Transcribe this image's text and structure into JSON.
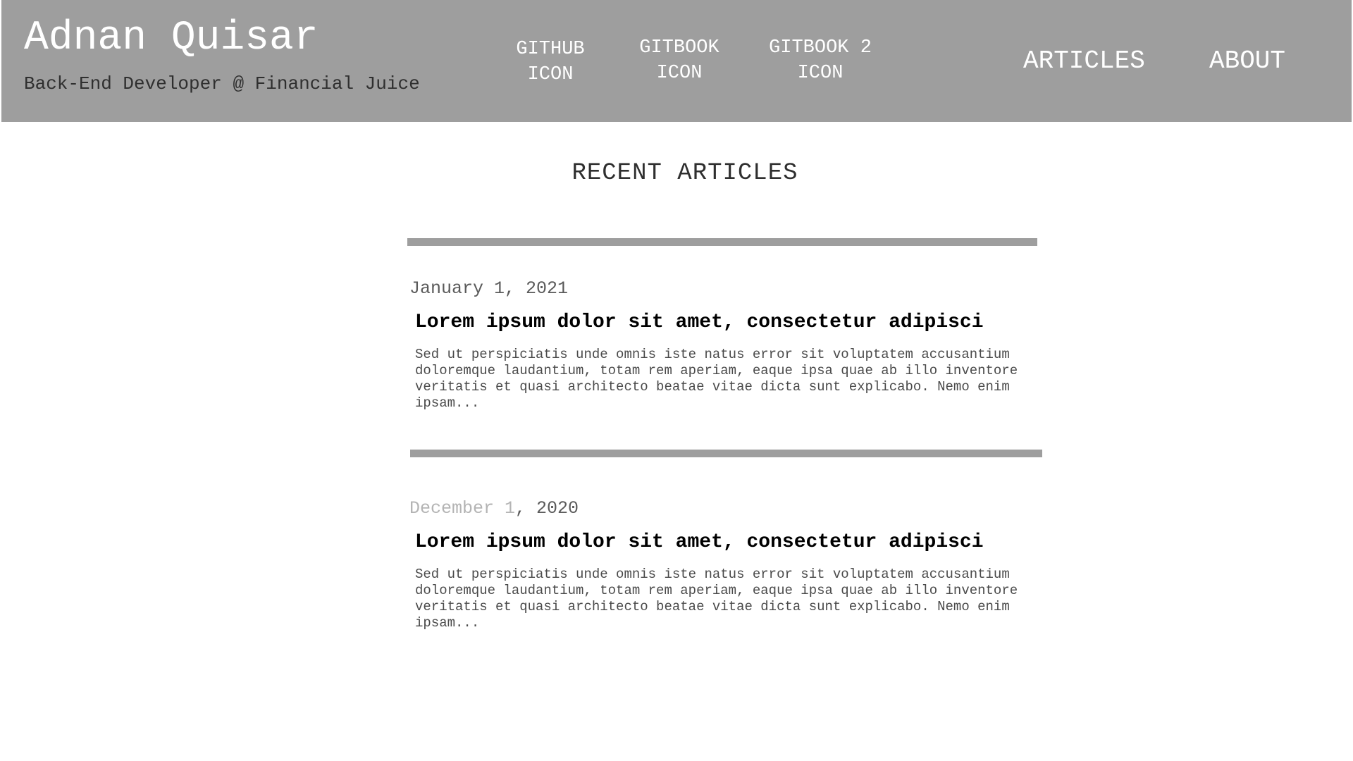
{
  "header": {
    "title": "Adnan Quisar",
    "subtitle": "Back-End Developer @ Financial Juice",
    "icons": [
      {
        "line1": "GITHUB",
        "line2": "ICON"
      },
      {
        "line1": "GITBOOK",
        "line2": "ICON"
      },
      {
        "line1": "GITBOOK 2",
        "line2": "ICON"
      }
    ],
    "nav": {
      "articles": "ARTICLES",
      "about": "ABOUT"
    }
  },
  "main": {
    "section_title": "RECENT ARTICLES",
    "articles": [
      {
        "date": "January 1, 2021",
        "title": "Lorem ipsum dolor sit amet, consectetur adipisci",
        "excerpt": "Sed ut perspiciatis unde omnis iste natus error sit voluptatem accusantium\ndoloremque laudantium, totam rem aperiam, eaque ipsa quae ab illo inventore\nveritatis et quasi architecto beatae vitae dicta sunt explicabo. Nemo enim\nipsam..."
      },
      {
        "date_part1": "December 1",
        "date_part2": ", 2020",
        "title": "Lorem ipsum dolor sit amet, consectetur adipisci",
        "excerpt": "Sed ut perspiciatis unde omnis iste natus error sit voluptatem accusantium\ndoloremque laudantium, totam rem aperiam, eaque ipsa quae ab illo inventore\nveritatis et quasi architecto beatae vitae dicta sunt explicabo. Nemo enim\nipsam..."
      }
    ]
  },
  "colors": {
    "header_bg": "#9e9e9e",
    "divider": "#9e9e9e",
    "text_dark": "#2f2f2f"
  }
}
